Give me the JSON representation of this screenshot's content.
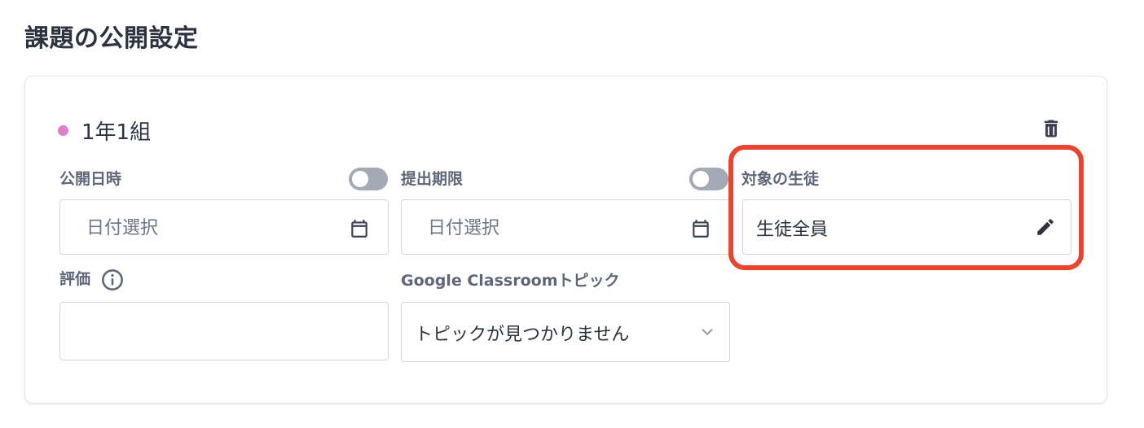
{
  "page": {
    "title": "課題の公開設定"
  },
  "class_card": {
    "class_name": "1年1組",
    "dot_color": "#e07fd0",
    "publish_datetime": {
      "label": "公開日時",
      "placeholder": "日付選択",
      "toggle_on": false
    },
    "due_date": {
      "label": "提出期限",
      "placeholder": "日付選択",
      "toggle_on": false
    },
    "target_students": {
      "label": "対象の生徒",
      "value": "生徒全員"
    },
    "grading": {
      "label": "評価",
      "value": ""
    },
    "classroom_topic": {
      "label": "Google Classroomトピック",
      "selected": "トピックが見つかりません"
    }
  },
  "icons": {
    "trash": "trash-icon",
    "calendar": "calendar-icon",
    "pencil": "pencil-icon",
    "info": "info-icon",
    "chevron": "chevron-down-icon"
  },
  "colors": {
    "highlight": "#e84430",
    "toggle_off": "#a3a9b5"
  }
}
